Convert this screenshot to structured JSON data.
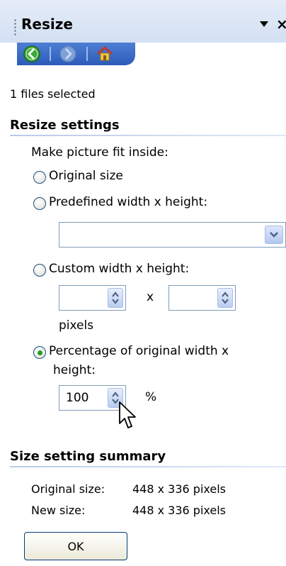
{
  "panel": {
    "title": "Resize",
    "dropdown_icon": "triangle-down-icon",
    "close_label": "×"
  },
  "nav": {
    "back_icon": "back-icon",
    "forward_icon": "forward-icon",
    "home_icon": "home-icon"
  },
  "files_selected": "1 files selected",
  "resize_settings": {
    "heading": "Resize settings",
    "fit_label": "Make picture fit inside:",
    "options": [
      {
        "label": "Original size",
        "checked": false
      },
      {
        "label": "Predefined width x height:",
        "checked": false
      },
      {
        "label": "Custom width x height:",
        "checked": false
      },
      {
        "label_line1": "Percentage of original width x",
        "label_line2": "height:",
        "checked": true
      }
    ],
    "predefined_value": "",
    "custom_width": "",
    "custom_height": "",
    "times_label": "x",
    "pixels_label": "pixels",
    "percentage_value": "100",
    "percent_unit": "%"
  },
  "summary": {
    "heading": "Size setting summary",
    "original_label": "Original size:",
    "original_value": "448 x 336 pixels",
    "new_label": "New size:",
    "new_value": "448 x 336 pixels"
  },
  "ok_label": "OK",
  "colors": {
    "accent": "#2b5bb7",
    "header_bg": "#d3e0f3",
    "selected_radio": "#21a121"
  }
}
